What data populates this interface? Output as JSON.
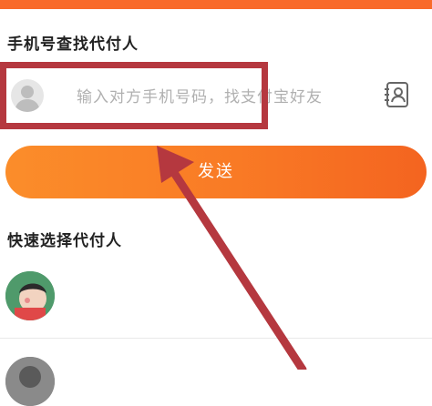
{
  "top_bar_color": "#f96a2a",
  "phone_section": {
    "title": "手机号查找代付人",
    "input_placeholder": "输入对方手机号码，找支付宝好友",
    "user_icon": "user-silhouette-icon",
    "contacts_icon": "contacts-book-icon"
  },
  "send_button": {
    "label": "发送",
    "gradient": [
      "#fb8d2a",
      "#f46420"
    ]
  },
  "quick_section": {
    "title": "快速选择代付人"
  },
  "annotation": {
    "color": "#b5383f"
  }
}
